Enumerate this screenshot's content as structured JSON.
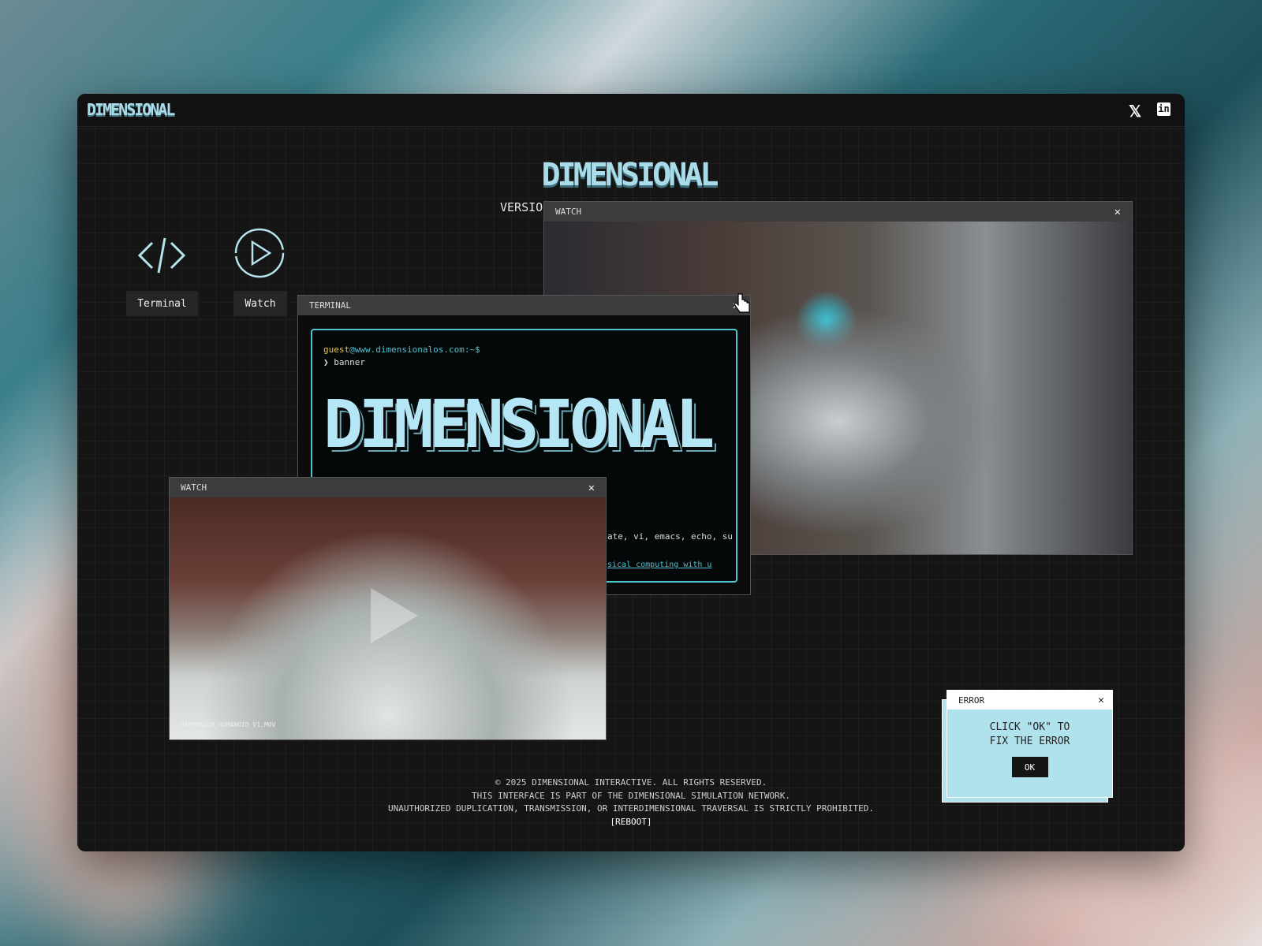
{
  "brand": {
    "logo": "DIMENSIONAL",
    "title": "DIMENSIONAL",
    "version_partial": "VERSIO"
  },
  "social": {
    "x_icon": "𝕏",
    "linkedin_icon": "in"
  },
  "desktop": {
    "icons": [
      {
        "label": "Terminal",
        "icon": "code-icon"
      },
      {
        "label": "Watch",
        "icon": "play-icon"
      }
    ]
  },
  "watch_large": {
    "title": "WATCH",
    "close": "✕"
  },
  "terminal": {
    "title": "TERMINAL",
    "close": "✕",
    "prompt_user": "guest",
    "prompt_host": "@www.dimensionalos.com:~$",
    "command": "❯ banner",
    "banner": "DIMENSIONAL",
    "help_partial": "ate, vi, emacs, echo, su",
    "help_partial2": "sical computing with u"
  },
  "watch_small": {
    "title": "WATCH",
    "close": "✕",
    "filename": "DIMENSION_HUMANOID_V1.MOV"
  },
  "error": {
    "title": "ERROR",
    "close": "✕",
    "message_line1": "CLICK \"OK\" TO",
    "message_line2": "FIX THE ERROR",
    "ok": "OK"
  },
  "footer": {
    "line1": "© 2025 DIMENSIONAL INTERACTIVE. ALL RIGHTS RESERVED.",
    "line2": "THIS INTERFACE IS PART OF THE DIMENSIONAL SIMULATION NETWORK.",
    "line3": "UNAUTHORIZED DUPLICATION, TRANSMISSION, OR INTERDIMENSIONAL TRAVERSAL IS STRICTLY PROHIBITED.",
    "reboot": "[REBOOT]"
  },
  "colors": {
    "accent": "#a9dbe8",
    "terminal_border": "#4fc3cf",
    "prompt_user": "#e8c34a",
    "prompt_host": "#4fc3cf",
    "error_bg": "#b0e2ee"
  }
}
